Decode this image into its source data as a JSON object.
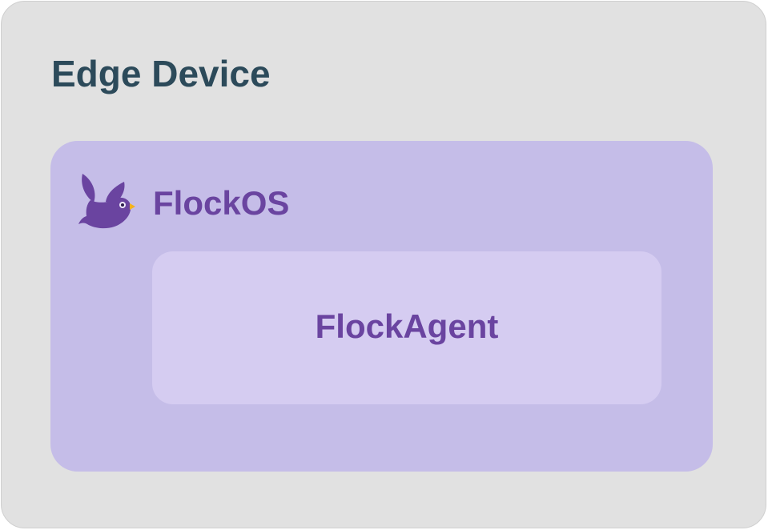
{
  "device": {
    "title": "Edge Device"
  },
  "os": {
    "title": "FlockOS",
    "logo_icon": "bird-icon"
  },
  "agent": {
    "title": "FlockAgent"
  },
  "colors": {
    "device_bg": "#e1e1e1",
    "device_title": "#2c4a5a",
    "os_bg": "#c5bde8",
    "agent_bg": "#d5ccf1",
    "brand_purple": "#6a44a0",
    "beak": "#f4b21c"
  }
}
